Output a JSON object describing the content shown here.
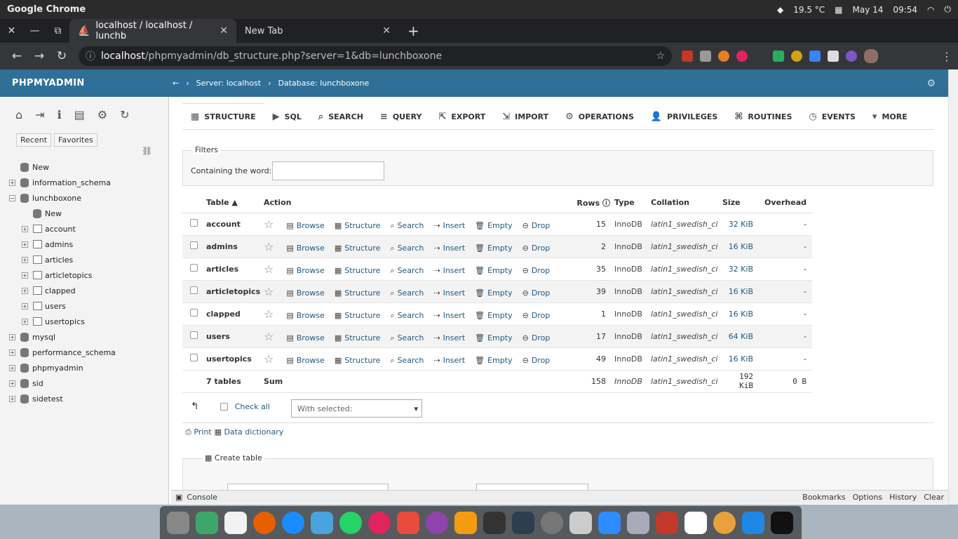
{
  "os": {
    "app_name": "Google Chrome",
    "temperature": "19.5 °C",
    "date": "May 14",
    "time": "09:54"
  },
  "browser": {
    "tabs": [
      {
        "label": "localhost / localhost / lunchb",
        "active": true
      },
      {
        "label": "New Tab",
        "active": false
      }
    ],
    "url_host": "localhost",
    "url_path": "/phpmyadmin/db_structure.php?server=1&db=lunchboxone"
  },
  "pma": {
    "logo": "PHPMYADMIN",
    "breadcrumb": {
      "server": "Server: localhost",
      "database": "Database: lunchboxone"
    },
    "left_tabs": [
      "Recent",
      "Favorites"
    ],
    "tree": [
      {
        "label": "New",
        "level": 0,
        "kind": "new"
      },
      {
        "label": "information_schema",
        "level": 0,
        "kind": "db"
      },
      {
        "label": "lunchboxone",
        "level": 0,
        "kind": "db",
        "open": true
      },
      {
        "label": "New",
        "level": 1,
        "kind": "new"
      },
      {
        "label": "account",
        "level": 1,
        "kind": "tbl"
      },
      {
        "label": "admins",
        "level": 1,
        "kind": "tbl"
      },
      {
        "label": "articles",
        "level": 1,
        "kind": "tbl"
      },
      {
        "label": "articletopics",
        "level": 1,
        "kind": "tbl"
      },
      {
        "label": "clapped",
        "level": 1,
        "kind": "tbl"
      },
      {
        "label": "users",
        "level": 1,
        "kind": "tbl"
      },
      {
        "label": "usertopics",
        "level": 1,
        "kind": "tbl"
      },
      {
        "label": "mysql",
        "level": 0,
        "kind": "db"
      },
      {
        "label": "performance_schema",
        "level": 0,
        "kind": "db"
      },
      {
        "label": "phpmyadmin",
        "level": 0,
        "kind": "db"
      },
      {
        "label": "sid",
        "level": 0,
        "kind": "db"
      },
      {
        "label": "sidetest",
        "level": 0,
        "kind": "db"
      }
    ],
    "main_tabs": [
      {
        "label": "STRUCTURE",
        "icon": "structure-icon"
      },
      {
        "label": "SQL",
        "icon": "sql-icon"
      },
      {
        "label": "SEARCH",
        "icon": "search-icon"
      },
      {
        "label": "QUERY",
        "icon": "query-icon"
      },
      {
        "label": "EXPORT",
        "icon": "export-icon"
      },
      {
        "label": "IMPORT",
        "icon": "import-icon"
      },
      {
        "label": "OPERATIONS",
        "icon": "operations-icon"
      },
      {
        "label": "PRIVILEGES",
        "icon": "privileges-icon"
      },
      {
        "label": "ROUTINES",
        "icon": "routines-icon"
      },
      {
        "label": "EVENTS",
        "icon": "events-icon"
      },
      {
        "label": "MORE",
        "icon": "more-icon"
      }
    ],
    "filters": {
      "legend": "Filters",
      "label": "Containing the word:",
      "value": ""
    },
    "table_headers": {
      "table": "Table",
      "action": "Action",
      "rows": "Rows",
      "type": "Type",
      "collation": "Collation",
      "size": "Size",
      "overhead": "Overhead"
    },
    "actions": [
      "Browse",
      "Structure",
      "Search",
      "Insert",
      "Empty",
      "Drop"
    ],
    "tables": [
      {
        "name": "account",
        "rows": "15",
        "type": "InnoDB",
        "collation": "latin1_swedish_ci",
        "size": "32 KiB",
        "overhead": "-"
      },
      {
        "name": "admins",
        "rows": "2",
        "type": "InnoDB",
        "collation": "latin1_swedish_ci",
        "size": "16 KiB",
        "overhead": "-"
      },
      {
        "name": "articles",
        "rows": "35",
        "type": "InnoDB",
        "collation": "latin1_swedish_ci",
        "size": "32 KiB",
        "overhead": "-"
      },
      {
        "name": "articletopics",
        "rows": "39",
        "type": "InnoDB",
        "collation": "latin1_swedish_ci",
        "size": "16 KiB",
        "overhead": "-"
      },
      {
        "name": "clapped",
        "rows": "1",
        "type": "InnoDB",
        "collation": "latin1_swedish_ci",
        "size": "16 KiB",
        "overhead": "-"
      },
      {
        "name": "users",
        "rows": "17",
        "type": "InnoDB",
        "collation": "latin1_swedish_ci",
        "size": "64 KiB",
        "overhead": "-"
      },
      {
        "name": "usertopics",
        "rows": "49",
        "type": "InnoDB",
        "collation": "latin1_swedish_ci",
        "size": "16 KiB",
        "overhead": "-"
      }
    ],
    "sum": {
      "label": "7 tables",
      "sum_label": "Sum",
      "rows": "158",
      "type": "InnoDB",
      "collation": "latin1_swedish_ci",
      "size": "192 KiB",
      "overhead": "0 B"
    },
    "check_all": "Check all",
    "with_selected": "With selected:",
    "print": "Print",
    "data_dictionary": "Data dictionary",
    "create_table": "Create table",
    "console": {
      "label": "Console",
      "links": [
        "Bookmarks",
        "Options",
        "History",
        "Clear"
      ]
    }
  }
}
